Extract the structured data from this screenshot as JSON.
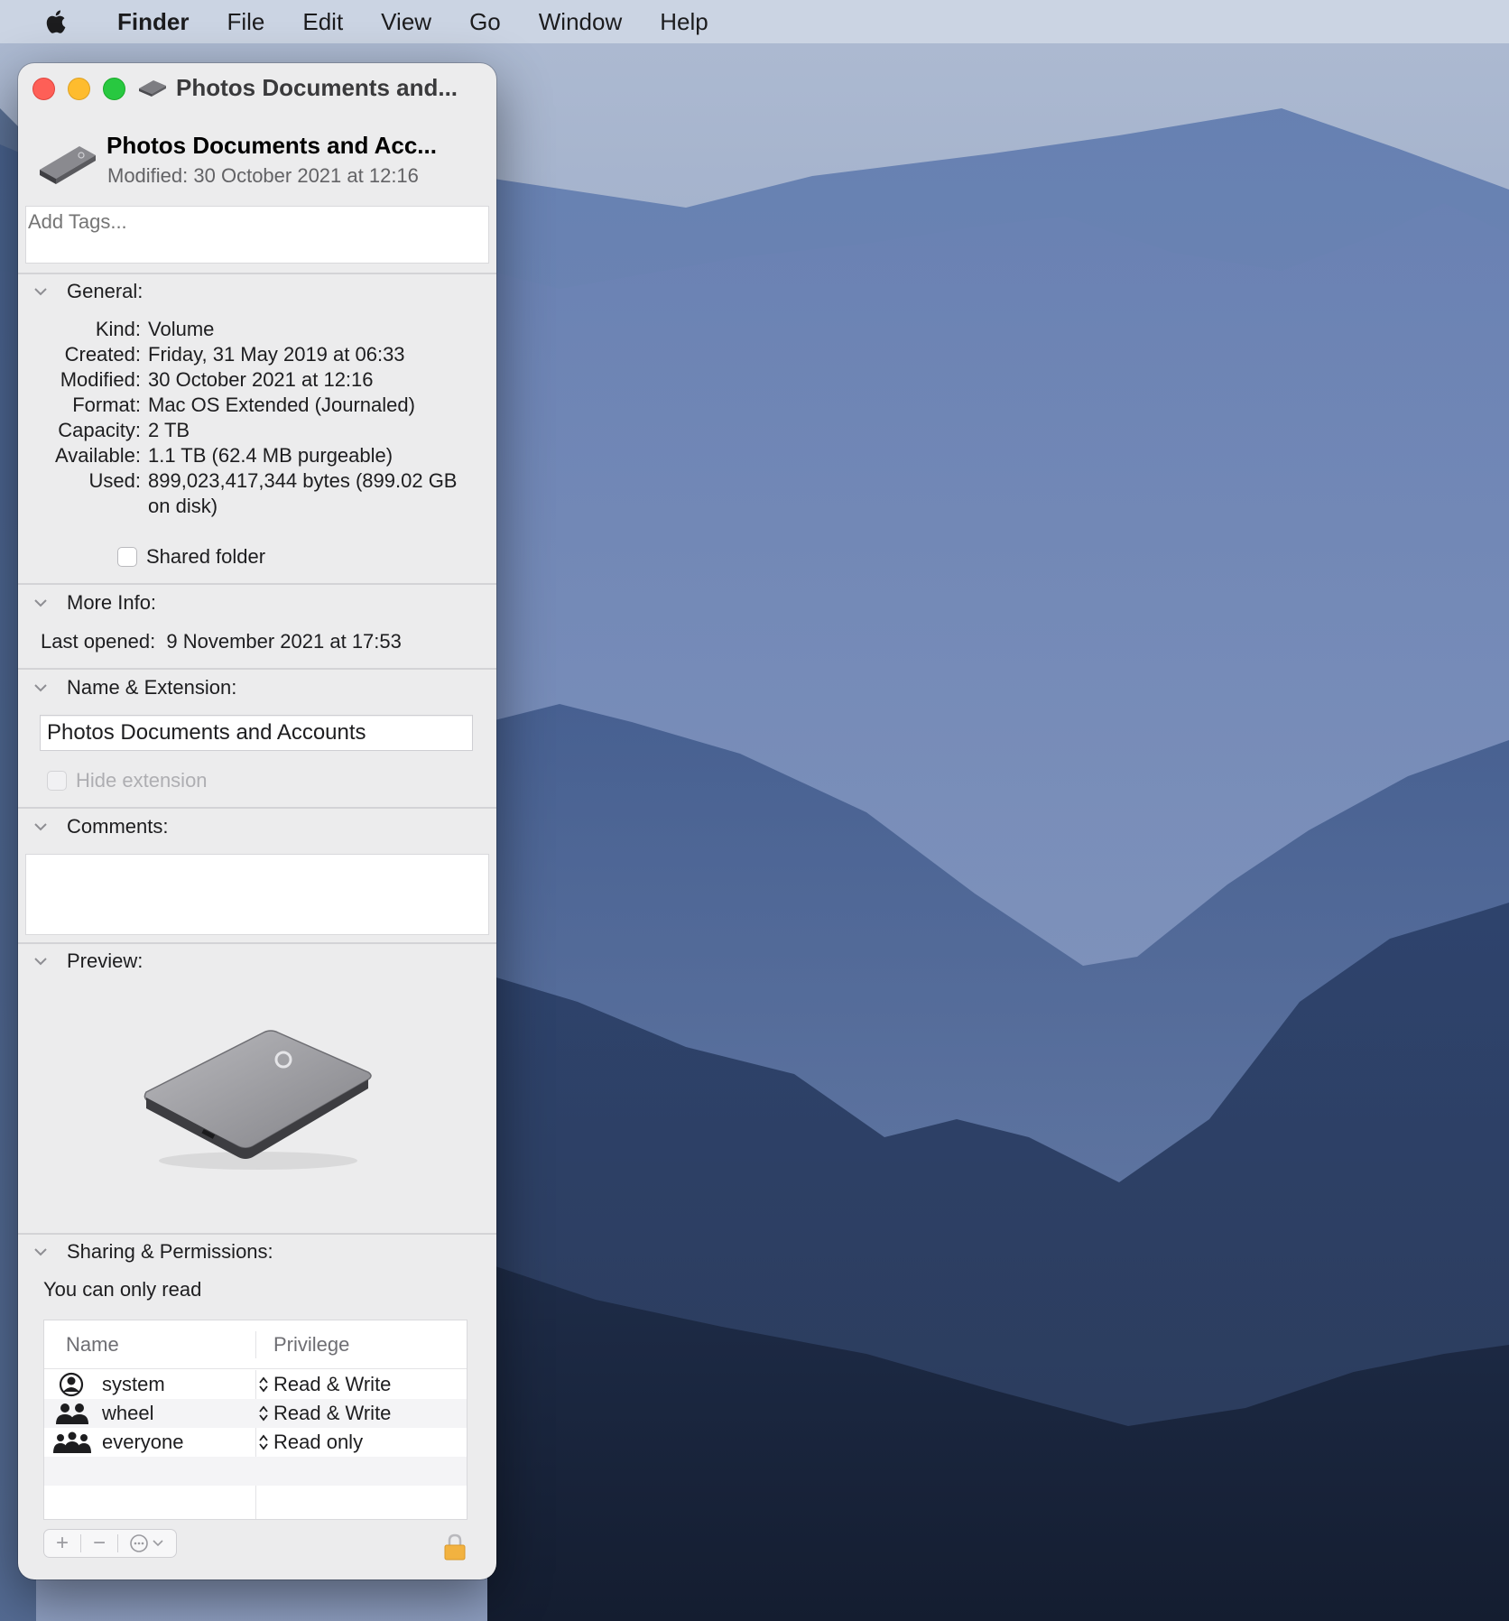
{
  "menubar": {
    "apple_icon": "apple-logo-icon",
    "app_name": "Finder",
    "items": [
      "File",
      "Edit",
      "View",
      "Go",
      "Window",
      "Help"
    ]
  },
  "window": {
    "title": "Photos Documents and...",
    "title_icon": "external-drive-icon",
    "traffic_lights": {
      "close": "#fe5f57",
      "minimize": "#febc2e",
      "zoom": "#28c840"
    }
  },
  "header": {
    "name": "Photos Documents and Acc...",
    "modified": "Modified: 30 October 2021 at 12:16"
  },
  "tags": {
    "placeholder": "Add Tags..."
  },
  "general": {
    "heading": "General:",
    "rows": [
      {
        "label": "Kind:",
        "value": "Volume"
      },
      {
        "label": "Created:",
        "value": "Friday, 31 May 2019 at 06:33"
      },
      {
        "label": "Modified:",
        "value": "30 October 2021 at 12:16"
      },
      {
        "label": "Format:",
        "value": "Mac OS Extended (Journaled)"
      },
      {
        "label": "Capacity:",
        "value": "2 TB"
      },
      {
        "label": "Available:",
        "value": "1.1 TB (62.4 MB purgeable)"
      },
      {
        "label": "Used:",
        "value": "899,023,417,344 bytes (899.02 GB on disk)"
      }
    ],
    "shared_folder_label": "Shared folder",
    "shared_folder_checked": false
  },
  "more_info": {
    "heading": "More Info:",
    "last_opened_label": "Last opened:",
    "last_opened_value": "9 November 2021 at 17:53"
  },
  "name_extension": {
    "heading": "Name & Extension:",
    "name_value": "Photos Documents and Accounts",
    "hide_extension_label": "Hide extension",
    "hide_extension_checked": false
  },
  "comments": {
    "heading": "Comments:",
    "value": ""
  },
  "preview": {
    "heading": "Preview:"
  },
  "sharing": {
    "heading": "Sharing & Permissions:",
    "status": "You can only read",
    "columns": [
      "Name",
      "Privilege"
    ],
    "rows": [
      {
        "name": "system",
        "icon": "single-user-icon",
        "privilege": "Read & Write"
      },
      {
        "name": "wheel",
        "icon": "group-icon",
        "privilege": "Read & Write"
      },
      {
        "name": "everyone",
        "icon": "everyone-icon",
        "privilege": "Read only"
      }
    ],
    "toolbar": {
      "add": "+",
      "remove": "−"
    }
  }
}
